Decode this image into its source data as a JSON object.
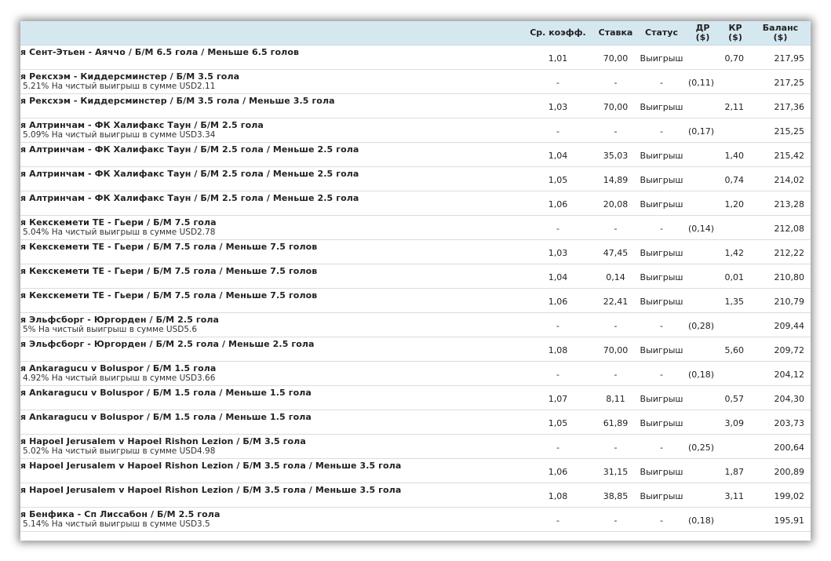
{
  "headers": {
    "odds": "Ср. коэфф.",
    "stake": "Ставка",
    "status": "Статус",
    "dr": "ДР ($)",
    "kr": "КР ($)",
    "balance": "Баланс ($)"
  },
  "rows": [
    {
      "title": "я Сент-Этьен - Аяччо / Б/М 6.5 гола / Меньше 6.5 голов",
      "sub": "",
      "odds": "1,01",
      "stake": "70,00",
      "status": "Выигрыш",
      "dr": "",
      "kr": "0,70",
      "balance": "217,95"
    },
    {
      "title": "я Рексхэм - Киддерсминстер / Б/М 3.5 гола",
      "sub": "5.21% На чистый выигрыш в сумме USD2.11",
      "odds": "-",
      "stake": "-",
      "status": "-",
      "dr": "(0,11)",
      "kr": "",
      "balance": "217,25"
    },
    {
      "title": "я Рексхэм - Киддерсминстер / Б/М 3.5 гола / Меньше 3.5 гола",
      "sub": "",
      "odds": "1,03",
      "stake": "70,00",
      "status": "Выигрыш",
      "dr": "",
      "kr": "2,11",
      "balance": "217,36"
    },
    {
      "title": "я Алтринчам - ФК Халифакс Таун / Б/М 2.5 гола",
      "sub": "5.09% На чистый выигрыш в сумме USD3.34",
      "odds": "-",
      "stake": "-",
      "status": "-",
      "dr": "(0,17)",
      "kr": "",
      "balance": "215,25"
    },
    {
      "title": "я Алтринчам - ФК Халифакс Таун / Б/М 2.5 гола / Меньше 2.5 гола",
      "sub": "",
      "odds": "1,04",
      "stake": "35,03",
      "status": "Выигрыш",
      "dr": "",
      "kr": "1,40",
      "balance": "215,42"
    },
    {
      "title": "я Алтринчам - ФК Халифакс Таун / Б/М 2.5 гола / Меньше 2.5 гола",
      "sub": "",
      "odds": "1,05",
      "stake": "14,89",
      "status": "Выигрыш",
      "dr": "",
      "kr": "0,74",
      "balance": "214,02"
    },
    {
      "title": "я Алтринчам - ФК Халифакс Таун / Б/М 2.5 гола / Меньше 2.5 гола",
      "sub": "",
      "odds": "1,06",
      "stake": "20,08",
      "status": "Выигрыш",
      "dr": "",
      "kr": "1,20",
      "balance": "213,28"
    },
    {
      "title": "я Кекскемети ТЕ - Гьери / Б/М 7.5 гола",
      "sub": "5.04% На чистый выигрыш в сумме USD2.78",
      "odds": "-",
      "stake": "-",
      "status": "-",
      "dr": "(0,14)",
      "kr": "",
      "balance": "212,08"
    },
    {
      "title": "я Кекскемети ТЕ - Гьери / Б/М 7.5 гола / Меньше 7.5 голов",
      "sub": "",
      "odds": "1,03",
      "stake": "47,45",
      "status": "Выигрыш",
      "dr": "",
      "kr": "1,42",
      "balance": "212,22"
    },
    {
      "title": "я Кекскемети ТЕ - Гьери / Б/М 7.5 гола / Меньше 7.5 голов",
      "sub": "",
      "odds": "1,04",
      "stake": "0,14",
      "status": "Выигрыш",
      "dr": "",
      "kr": "0,01",
      "balance": "210,80"
    },
    {
      "title": "я Кекскемети ТЕ - Гьери / Б/М 7.5 гола / Меньше 7.5 голов",
      "sub": "",
      "odds": "1,06",
      "stake": "22,41",
      "status": "Выигрыш",
      "dr": "",
      "kr": "1,35",
      "balance": "210,79"
    },
    {
      "title": "я Эльфсборг - Юргорден / Б/М 2.5 гола",
      "sub": "5% На чистый выигрыш в сумме USD5.6",
      "odds": "-",
      "stake": "-",
      "status": "-",
      "dr": "(0,28)",
      "kr": "",
      "balance": "209,44"
    },
    {
      "title": "я Эльфсборг - Юргорден / Б/М 2.5 гола / Меньше 2.5 гола",
      "sub": "",
      "odds": "1,08",
      "stake": "70,00",
      "status": "Выигрыш",
      "dr": "",
      "kr": "5,60",
      "balance": "209,72"
    },
    {
      "title": "я Ankaragucu v Boluspor / Б/М 1.5 гола",
      "sub": "4.92% На чистый выигрыш в сумме USD3.66",
      "odds": "-",
      "stake": "-",
      "status": "-",
      "dr": "(0,18)",
      "kr": "",
      "balance": "204,12"
    },
    {
      "title": "я Ankaragucu v Boluspor / Б/М 1.5 гола / Меньше 1.5 гола",
      "sub": "",
      "odds": "1,07",
      "stake": "8,11",
      "status": "Выигрыш",
      "dr": "",
      "kr": "0,57",
      "balance": "204,30"
    },
    {
      "title": "я Ankaragucu v Boluspor / Б/М 1.5 гола / Меньше 1.5 гола",
      "sub": "",
      "odds": "1,05",
      "stake": "61,89",
      "status": "Выигрыш",
      "dr": "",
      "kr": "3,09",
      "balance": "203,73"
    },
    {
      "title": "я Hapoel Jerusalem v Hapoel Rishon Lezion / Б/М 3.5 гола",
      "sub": "5.02% На чистый выигрыш в сумме USD4.98",
      "odds": "-",
      "stake": "-",
      "status": "-",
      "dr": "(0,25)",
      "kr": "",
      "balance": "200,64"
    },
    {
      "title": "я Hapoel Jerusalem v Hapoel Rishon Lezion / Б/М 3.5 гола / Меньше 3.5 гола",
      "sub": "",
      "odds": "1,06",
      "stake": "31,15",
      "status": "Выигрыш",
      "dr": "",
      "kr": "1,87",
      "balance": "200,89"
    },
    {
      "title": "я Hapoel Jerusalem v Hapoel Rishon Lezion / Б/М 3.5 гола / Меньше 3.5 гола",
      "sub": "",
      "odds": "1,08",
      "stake": "38,85",
      "status": "Выигрыш",
      "dr": "",
      "kr": "3,11",
      "balance": "199,02"
    },
    {
      "title": "я Бенфика - Сп Лиссабон / Б/М 2.5 гола",
      "sub": "5.14% На чистый выигрыш в сумме USD3.5",
      "odds": "-",
      "stake": "-",
      "status": "-",
      "dr": "(0,18)",
      "kr": "",
      "balance": "195,91"
    }
  ]
}
